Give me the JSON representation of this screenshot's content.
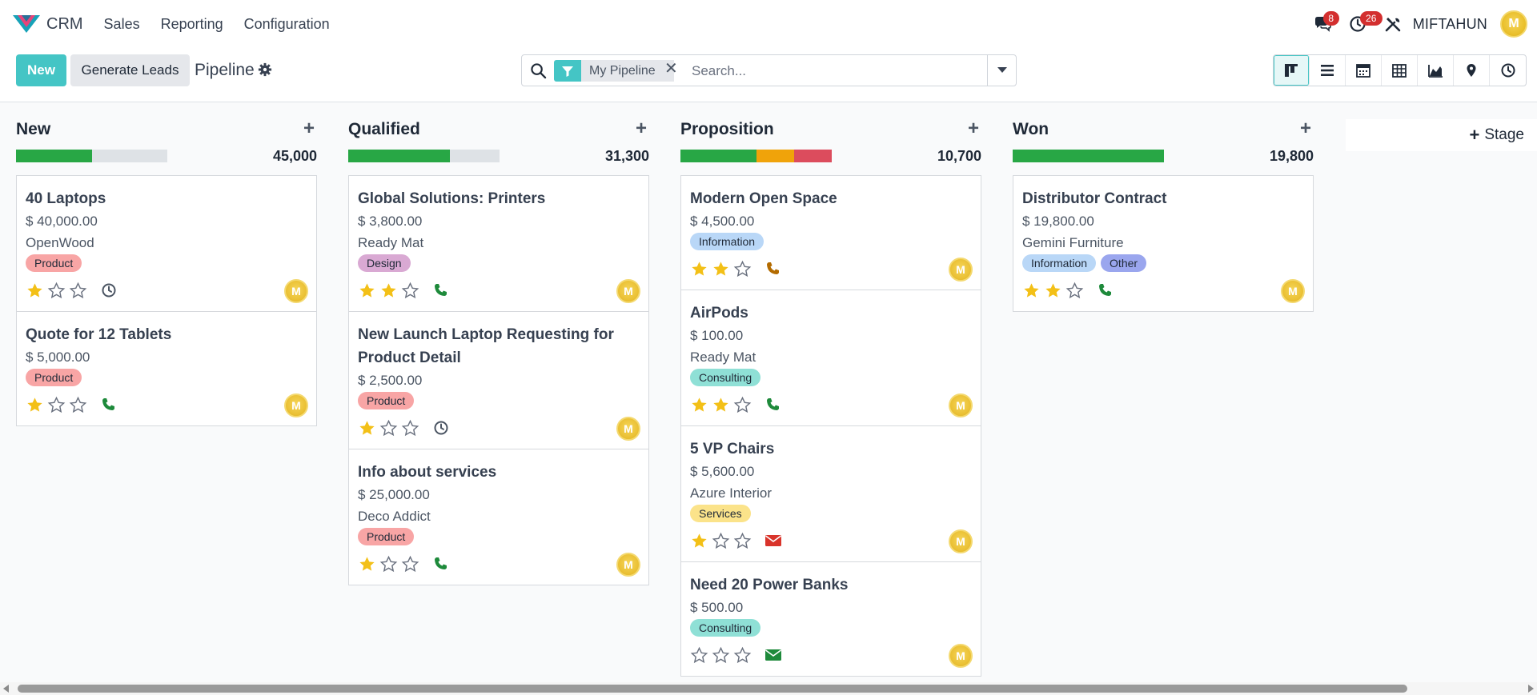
{
  "navbar": {
    "app_name": "CRM",
    "menu": [
      "Sales",
      "Reporting",
      "Configuration"
    ],
    "messages_count": "8",
    "activities_count": "26",
    "user_name": "MIFTAHUN",
    "avatar_letter": "M"
  },
  "control": {
    "new_label": "New",
    "generate_label": "Generate Leads",
    "breadcrumb": "Pipeline",
    "facet_label": "My Pipeline",
    "search_placeholder": "Search...",
    "active_view": "kanban",
    "views": [
      "kanban",
      "list",
      "calendar",
      "pivot",
      "graph",
      "map",
      "activity"
    ]
  },
  "colors": {
    "accent": "#44c5c5",
    "progress_green": "#28a745",
    "progress_orange": "#f0a30a",
    "progress_red": "#dc4c5d",
    "star_filled": "#f3c017",
    "phone_green": "#1e8a3b",
    "phone_orange": "#b36b00",
    "mail_red": "#d9342b",
    "mail_green": "#1e8a3b"
  },
  "add_stage_label": "Stage",
  "columns": [
    {
      "title": "New",
      "total": "45,000",
      "progress": [
        {
          "fraction": 0.5,
          "color": "#28a745"
        }
      ],
      "cards": [
        {
          "name": "40 Laptops",
          "amount": "$ 40,000.00",
          "customer": "OpenWood",
          "tags": [
            {
              "label": "Product",
              "color": "#f8a5a5"
            }
          ],
          "stars": 1,
          "activity": "clock"
        },
        {
          "name": "Quote for 12 Tablets",
          "amount": "$ 5,000.00",
          "customer": "",
          "tags": [
            {
              "label": "Product",
              "color": "#f8a5a5"
            }
          ],
          "stars": 1,
          "activity": "phone-green"
        }
      ]
    },
    {
      "title": "Qualified",
      "total": "31,300",
      "progress": [
        {
          "fraction": 0.67,
          "color": "#28a745"
        }
      ],
      "cards": [
        {
          "name": "Global Solutions: Printers",
          "amount": "$ 3,800.00",
          "customer": "Ready Mat",
          "tags": [
            {
              "label": "Design",
              "color": "#d9a9d3"
            }
          ],
          "stars": 2,
          "activity": "phone-green"
        },
        {
          "name": "New Launch Laptop Requesting for Product Detail",
          "amount": "$ 2,500.00",
          "customer": "",
          "tags": [
            {
              "label": "Product",
              "color": "#f8a5a5"
            }
          ],
          "stars": 1,
          "activity": "clock"
        },
        {
          "name": "Info about services",
          "amount": "$ 25,000.00",
          "customer": "Deco Addict",
          "tags": [
            {
              "label": "Product",
              "color": "#f8a5a5"
            }
          ],
          "stars": 1,
          "activity": "phone-green"
        }
      ]
    },
    {
      "title": "Proposition",
      "total": "10,700",
      "progress": [
        {
          "fraction": 0.5,
          "color": "#28a745"
        },
        {
          "fraction": 0.25,
          "color": "#f0a30a"
        },
        {
          "fraction": 0.25,
          "color": "#dc4c5d"
        }
      ],
      "cards": [
        {
          "name": "Modern Open Space",
          "amount": "$ 4,500.00",
          "customer": "",
          "tags": [
            {
              "label": "Information",
              "color": "#b9d7f7"
            }
          ],
          "stars": 2,
          "activity": "phone-orange"
        },
        {
          "name": "AirPods",
          "amount": "$ 100.00",
          "customer": "Ready Mat",
          "tags": [
            {
              "label": "Consulting",
              "color": "#8fe0d6"
            }
          ],
          "stars": 2,
          "activity": "phone-green"
        },
        {
          "name": "5 VP Chairs",
          "amount": "$ 5,600.00",
          "customer": "Azure Interior",
          "tags": [
            {
              "label": "Services",
              "color": "#fbe38a"
            }
          ],
          "stars": 1,
          "activity": "mail-red"
        },
        {
          "name": "Need 20 Power Banks",
          "amount": "$ 500.00",
          "customer": "",
          "tags": [
            {
              "label": "Consulting",
              "color": "#8fe0d6"
            }
          ],
          "stars": 0,
          "activity": "mail-green"
        }
      ]
    },
    {
      "title": "Won",
      "total": "19,800",
      "progress": [
        {
          "fraction": 1.0,
          "color": "#28a745"
        }
      ],
      "cards": [
        {
          "name": "Distributor Contract",
          "amount": "$ 19,800.00",
          "customer": "Gemini Furniture",
          "tags": [
            {
              "label": "Information",
              "color": "#b9d7f7"
            },
            {
              "label": "Other",
              "color": "#9aa6ee"
            }
          ],
          "stars": 2,
          "activity": "phone-green"
        }
      ]
    }
  ]
}
